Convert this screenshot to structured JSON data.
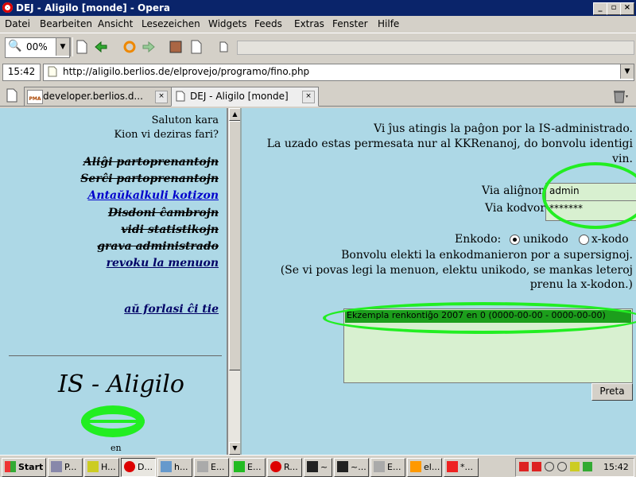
{
  "window": {
    "title": "DEJ - Aligilo [monde] - Opera"
  },
  "menu": [
    "Datei",
    "Bearbeiten",
    "Ansicht",
    "Lesezeichen",
    "Widgets",
    "Feeds",
    "Extras",
    "Fenster",
    "Hilfe"
  ],
  "toolbar": {
    "zoom": "00%"
  },
  "address": {
    "time": "15:42",
    "url": "http://aligilo.berlios.de/elprovejo/programo/fino.php"
  },
  "tabs": [
    {
      "label": "developer.berlios.d...",
      "icon_text": "PMA"
    },
    {
      "label": "DEJ - Aligilo [monde]"
    }
  ],
  "left": {
    "greeting": "Saluton kara",
    "question": "Kion vi deziras fari?",
    "nav": [
      "Aliĝi partoprenantojn",
      "Serĉi partoprenantojn",
      "Antaŭkalkuli kotizon",
      "Disdoni ĉambrojn",
      "vidi statistikojn",
      "grava administrado",
      "revoku la menuon"
    ],
    "exit": "aŭ forlasi ĉi tie",
    "logo_text": "IS - Aligilo",
    "bottom_text": "en"
  },
  "right": {
    "intro1": "Vi ĵus atingis la paĝon por la IS-administrado.",
    "intro2": "La uzado estas permesata nur al KKRenanoj, do bonvolu identigi",
    "intro3": "vin.",
    "login_label": "Via aliĝnomo:",
    "login_value": "admin",
    "password_label": "Via kodvorto:",
    "password_value": "*******",
    "encoding_label": "Enkodo:",
    "encoding_opt1": "unikodo",
    "encoding_opt2": "x-kodo",
    "encoding_help1": "Bonvolu elekti la enkodmanieron por a supersignoj.",
    "encoding_help2": "(Se vi povas legi la menuon, elektu unikodo, se mankas leteroj",
    "encoding_help3": "prenu la x-kodon.)",
    "selected_meeting": "Ekzempla renkontiĝo 2007  en 0 (0000-00-00 - 0000-00-00)",
    "submit": "Preta"
  },
  "taskbar": {
    "start": "Start",
    "items": [
      "P...",
      "H...",
      "D...",
      "h...",
      "E...",
      "E...",
      "R...",
      "~",
      "~...",
      "E...",
      "el...",
      "*..."
    ],
    "clock": "15:42"
  },
  "colors": {
    "page_bg": "#add8e6",
    "field_bg": "#d8f0d0",
    "highlight": "#22ee22",
    "title_bar": "#0a246a"
  }
}
